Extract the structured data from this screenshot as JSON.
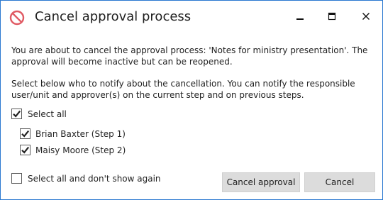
{
  "window": {
    "title": "Cancel approval process",
    "icon": "prohibited-icon",
    "accent_color": "#2b79d0",
    "icon_color": "#e05a63"
  },
  "message": {
    "line1": "You are about to cancel the approval process: 'Notes for ministry presentation'. The approval will become inactive but can be reopened.",
    "line2": "Select below who to notify about the cancellation. You can notify the responsible user/unit and approver(s) on the current step and on previous steps."
  },
  "checkboxes": {
    "select_all": {
      "label": "Select all",
      "checked": true
    },
    "recipients": [
      {
        "label": "Brian Baxter (Step 1)",
        "checked": true
      },
      {
        "label": "Maisy Moore (Step 2)",
        "checked": true
      }
    ],
    "dont_show_again": {
      "label": "Select all and don't show again",
      "checked": false
    }
  },
  "buttons": {
    "cancel_approval": "Cancel approval",
    "cancel": "Cancel"
  }
}
